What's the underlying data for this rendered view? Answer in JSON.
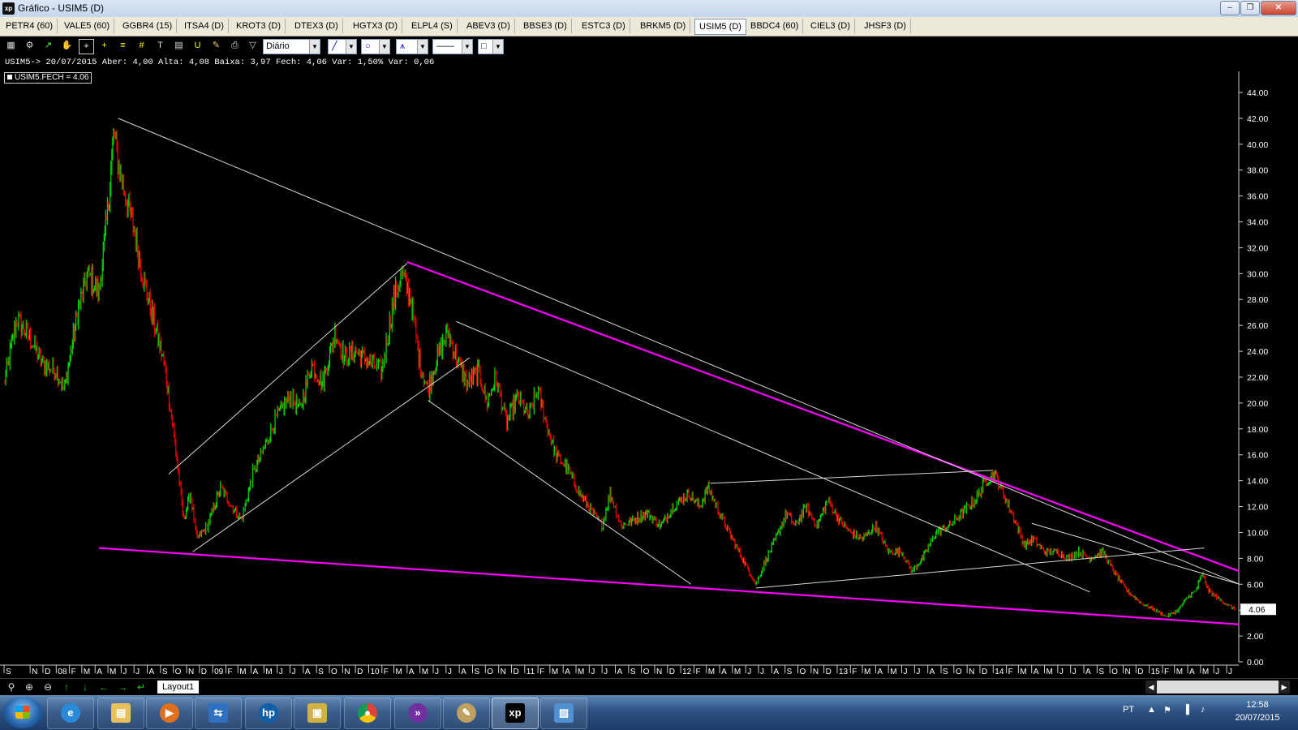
{
  "window": {
    "title": "Gráfico - USIM5 (D)",
    "app_icon": "xp"
  },
  "tabs": [
    "PETR4 (60)",
    "VALE5 (60)",
    "GGBR4 (15)",
    "ITSA4 (D)",
    "KROT3 (D)",
    "DTEX3 (D)",
    "HGTX3 (D)",
    "ELPL4 (S)",
    "ABEV3 (D)",
    "BBSE3 (D)",
    "ESTC3 (D)",
    "BRKM5 (D)",
    "USIM5 (D)",
    "BBDC4 (60)",
    "CIEL3 (D)",
    "JHSF3 (D)"
  ],
  "active_tab": "USIM5 (D)",
  "toolbar": {
    "period": "Diário"
  },
  "info_line": "USIM5-> 20/07/2015 Aber: 4,00 Alta: 4,08 Baixa: 3,97 Fech: 4,06 Var: 1,50% Var: 0,06",
  "legend": "USIM5.FECH = 4.06",
  "bottom": {
    "layout_tab": "Layout1"
  },
  "taskbar": {
    "lang": "PT",
    "time": "12:58",
    "date": "20/07/2015"
  },
  "colors": {
    "up": "#00d000",
    "down": "#e00000",
    "trend_magenta": "#ff00ff",
    "trend_white": "#d8d8d8",
    "background": "#000000"
  },
  "chart_data": {
    "type": "line",
    "title": "",
    "series": [
      {
        "name": "USIM5.FECH",
        "last_value": 4.06
      }
    ],
    "ylim": [
      0,
      45
    ],
    "yticks": [
      "0.00",
      "2.00",
      "4.00",
      "6.00",
      "8.00",
      "10.00",
      "12.00",
      "14.00",
      "16.00",
      "18.00",
      "20.00",
      "22.00",
      "24.00",
      "26.00",
      "28.00",
      "30.00",
      "32.00",
      "34.00",
      "36.00",
      "38.00",
      "40.00",
      "42.00",
      "44.00"
    ],
    "x_start": "2007-09",
    "x_end": "2015-07-20",
    "xticks": [
      {
        "d": "2007-09",
        "l": "S"
      },
      {
        "d": "2007-11",
        "l": "N"
      },
      {
        "d": "2007-12",
        "l": "D"
      },
      {
        "d": "2008-01",
        "l": "08"
      },
      {
        "d": "2008-02",
        "l": "F"
      },
      {
        "d": "2008-03",
        "l": "M"
      },
      {
        "d": "2008-04",
        "l": "A"
      },
      {
        "d": "2008-05",
        "l": "M"
      },
      {
        "d": "2008-06",
        "l": "J"
      },
      {
        "d": "2008-07",
        "l": "J"
      },
      {
        "d": "2008-08",
        "l": "A"
      },
      {
        "d": "2008-09",
        "l": "S"
      },
      {
        "d": "2008-10",
        "l": "O"
      },
      {
        "d": "2008-11",
        "l": "N"
      },
      {
        "d": "2008-12",
        "l": "D"
      },
      {
        "d": "2009-01",
        "l": "09"
      },
      {
        "d": "2009-02",
        "l": "F"
      },
      {
        "d": "2009-03",
        "l": "M"
      },
      {
        "d": "2009-04",
        "l": "A"
      },
      {
        "d": "2009-05",
        "l": "M"
      },
      {
        "d": "2009-06",
        "l": "J"
      },
      {
        "d": "2009-07",
        "l": "J"
      },
      {
        "d": "2009-08",
        "l": "A"
      },
      {
        "d": "2009-09",
        "l": "S"
      },
      {
        "d": "2009-10",
        "l": "O"
      },
      {
        "d": "2009-11",
        "l": "N"
      },
      {
        "d": "2009-12",
        "l": "D"
      },
      {
        "d": "2010-01",
        "l": "10"
      },
      {
        "d": "2010-02",
        "l": "F"
      },
      {
        "d": "2010-03",
        "l": "M"
      },
      {
        "d": "2010-04",
        "l": "A"
      },
      {
        "d": "2010-05",
        "l": "M"
      },
      {
        "d": "2010-06",
        "l": "J"
      },
      {
        "d": "2010-07",
        "l": "J"
      },
      {
        "d": "2010-08",
        "l": "A"
      },
      {
        "d": "2010-09",
        "l": "S"
      },
      {
        "d": "2010-10",
        "l": "O"
      },
      {
        "d": "2010-11",
        "l": "N"
      },
      {
        "d": "2010-12",
        "l": "D"
      },
      {
        "d": "2011-01",
        "l": "11"
      },
      {
        "d": "2011-02",
        "l": "F"
      },
      {
        "d": "2011-03",
        "l": "M"
      },
      {
        "d": "2011-04",
        "l": "A"
      },
      {
        "d": "2011-05",
        "l": "M"
      },
      {
        "d": "2011-06",
        "l": "J"
      },
      {
        "d": "2011-07",
        "l": "J"
      },
      {
        "d": "2011-08",
        "l": "A"
      },
      {
        "d": "2011-09",
        "l": "S"
      },
      {
        "d": "2011-10",
        "l": "O"
      },
      {
        "d": "2011-11",
        "l": "N"
      },
      {
        "d": "2011-12",
        "l": "D"
      },
      {
        "d": "2012-01",
        "l": "12"
      },
      {
        "d": "2012-02",
        "l": "F"
      },
      {
        "d": "2012-03",
        "l": "M"
      },
      {
        "d": "2012-04",
        "l": "A"
      },
      {
        "d": "2012-05",
        "l": "M"
      },
      {
        "d": "2012-06",
        "l": "J"
      },
      {
        "d": "2012-07",
        "l": "J"
      },
      {
        "d": "2012-08",
        "l": "A"
      },
      {
        "d": "2012-09",
        "l": "S"
      },
      {
        "d": "2012-10",
        "l": "O"
      },
      {
        "d": "2012-11",
        "l": "N"
      },
      {
        "d": "2012-12",
        "l": "D"
      },
      {
        "d": "2013-01",
        "l": "13"
      },
      {
        "d": "2013-02",
        "l": "F"
      },
      {
        "d": "2013-03",
        "l": "M"
      },
      {
        "d": "2013-04",
        "l": "A"
      },
      {
        "d": "2013-05",
        "l": "M"
      },
      {
        "d": "2013-06",
        "l": "J"
      },
      {
        "d": "2013-07",
        "l": "J"
      },
      {
        "d": "2013-08",
        "l": "A"
      },
      {
        "d": "2013-09",
        "l": "S"
      },
      {
        "d": "2013-10",
        "l": "O"
      },
      {
        "d": "2013-11",
        "l": "N"
      },
      {
        "d": "2013-12",
        "l": "D"
      },
      {
        "d": "2014-01",
        "l": "14"
      },
      {
        "d": "2014-02",
        "l": "F"
      },
      {
        "d": "2014-03",
        "l": "M"
      },
      {
        "d": "2014-04",
        "l": "A"
      },
      {
        "d": "2014-05",
        "l": "M"
      },
      {
        "d": "2014-06",
        "l": "J"
      },
      {
        "d": "2014-07",
        "l": "J"
      },
      {
        "d": "2014-08",
        "l": "A"
      },
      {
        "d": "2014-09",
        "l": "S"
      },
      {
        "d": "2014-10",
        "l": "O"
      },
      {
        "d": "2014-11",
        "l": "N"
      },
      {
        "d": "2014-12",
        "l": "D"
      },
      {
        "d": "2015-01",
        "l": "15"
      },
      {
        "d": "2015-02",
        "l": "F"
      },
      {
        "d": "2015-03",
        "l": "M"
      },
      {
        "d": "2015-04",
        "l": "A"
      },
      {
        "d": "2015-05",
        "l": "M"
      },
      {
        "d": "2015-06",
        "l": "J"
      },
      {
        "d": "2015-07",
        "l": "J"
      }
    ],
    "price_path": [
      [
        "2007-09-01",
        21.5
      ],
      [
        "2007-10-01",
        26.5
      ],
      [
        "2007-11-01",
        25.0
      ],
      [
        "2007-12-01",
        23.0
      ],
      [
        "2008-01-01",
        22.5
      ],
      [
        "2008-01-20",
        21.0
      ],
      [
        "2008-02-20",
        27.0
      ],
      [
        "2008-03-15",
        30.0
      ],
      [
        "2008-04-10",
        28.5
      ],
      [
        "2008-05-01",
        35.0
      ],
      [
        "2008-05-15",
        41.0
      ],
      [
        "2008-05-25",
        38.5
      ],
      [
        "2008-06-15",
        35.5
      ],
      [
        "2008-07-01",
        33.5
      ],
      [
        "2008-07-20",
        30.0
      ],
      [
        "2008-08-15",
        26.5
      ],
      [
        "2008-09-10",
        23.0
      ],
      [
        "2008-10-01",
        18.0
      ],
      [
        "2008-10-15",
        14.0
      ],
      [
        "2008-10-25",
        11.0
      ],
      [
        "2008-11-10",
        13.0
      ],
      [
        "2008-11-25",
        9.5
      ],
      [
        "2008-12-20",
        10.5
      ],
      [
        "2009-01-20",
        13.5
      ],
      [
        "2009-02-15",
        12.0
      ],
      [
        "2009-03-10",
        11.0
      ],
      [
        "2009-04-05",
        14.5
      ],
      [
        "2009-05-01",
        16.5
      ],
      [
        "2009-06-01",
        19.0
      ],
      [
        "2009-07-01",
        20.5
      ],
      [
        "2009-07-25",
        19.5
      ],
      [
        "2009-08-20",
        23.0
      ],
      [
        "2009-09-15",
        21.5
      ],
      [
        "2009-10-15",
        25.5
      ],
      [
        "2009-11-05",
        23.5
      ],
      [
        "2009-12-01",
        24.0
      ],
      [
        "2010-01-10",
        23.0
      ],
      [
        "2010-02-01",
        22.5
      ],
      [
        "2010-03-01",
        28.0
      ],
      [
        "2010-03-20",
        30.0
      ],
      [
        "2010-04-10",
        28.0
      ],
      [
        "2010-05-01",
        23.0
      ],
      [
        "2010-05-20",
        21.0
      ],
      [
        "2010-06-10",
        23.5
      ],
      [
        "2010-07-05",
        25.5
      ],
      [
        "2010-07-25",
        23.5
      ],
      [
        "2010-08-20",
        21.5
      ],
      [
        "2010-09-15",
        22.5
      ],
      [
        "2010-10-05",
        20.0
      ],
      [
        "2010-10-25",
        22.0
      ],
      [
        "2010-11-20",
        18.5
      ],
      [
        "2010-12-15",
        20.5
      ],
      [
        "2011-01-10",
        19.0
      ],
      [
        "2011-02-01",
        21.0
      ],
      [
        "2011-02-20",
        18.5
      ],
      [
        "2011-03-15",
        16.0
      ],
      [
        "2011-04-10",
        15.0
      ],
      [
        "2011-05-10",
        13.0
      ],
      [
        "2011-06-10",
        11.5
      ],
      [
        "2011-07-01",
        10.5
      ],
      [
        "2011-07-20",
        13.0
      ],
      [
        "2011-08-15",
        10.5
      ],
      [
        "2011-09-15",
        11.0
      ],
      [
        "2011-10-15",
        11.5
      ],
      [
        "2011-11-15",
        10.5
      ],
      [
        "2011-12-15",
        12.0
      ],
      [
        "2012-01-20",
        13.0
      ],
      [
        "2012-02-15",
        12.0
      ],
      [
        "2012-03-05",
        13.5
      ],
      [
        "2012-04-01",
        11.5
      ],
      [
        "2012-05-01",
        9.5
      ],
      [
        "2012-06-01",
        7.5
      ],
      [
        "2012-06-25",
        6.0
      ],
      [
        "2012-07-20",
        8.0
      ],
      [
        "2012-08-10",
        9.5
      ],
      [
        "2012-09-05",
        11.5
      ],
      [
        "2012-09-25",
        10.5
      ],
      [
        "2012-10-20",
        12.0
      ],
      [
        "2012-11-15",
        10.5
      ],
      [
        "2012-12-10",
        12.5
      ],
      [
        "2013-01-05",
        11.0
      ],
      [
        "2013-02-01",
        10.0
      ],
      [
        "2013-03-01",
        9.5
      ],
      [
        "2013-04-01",
        10.5
      ],
      [
        "2013-05-01",
        8.5
      ],
      [
        "2013-06-01",
        8.5
      ],
      [
        "2013-06-25",
        7.0
      ],
      [
        "2013-07-20",
        8.0
      ],
      [
        "2013-08-20",
        10.0
      ],
      [
        "2013-09-20",
        10.5
      ],
      [
        "2013-10-20",
        11.5
      ],
      [
        "2013-11-20",
        12.5
      ],
      [
        "2013-12-15",
        14.0
      ],
      [
        "2014-01-05",
        14.5
      ],
      [
        "2014-01-25",
        13.0
      ],
      [
        "2014-02-20",
        11.0
      ],
      [
        "2014-03-15",
        9.0
      ],
      [
        "2014-04-05",
        9.5
      ],
      [
        "2014-05-01",
        8.5
      ],
      [
        "2014-06-01",
        8.5
      ],
      [
        "2014-06-25",
        8.0
      ],
      [
        "2014-07-20",
        8.5
      ],
      [
        "2014-08-15",
        8.0
      ],
      [
        "2014-09-15",
        8.5
      ],
      [
        "2014-10-10",
        7.0
      ],
      [
        "2014-11-10",
        5.5
      ],
      [
        "2014-12-15",
        4.5
      ],
      [
        "2015-01-15",
        4.0
      ],
      [
        "2015-02-10",
        3.5
      ],
      [
        "2015-03-10",
        4.0
      ],
      [
        "2015-04-01",
        5.0
      ],
      [
        "2015-04-20",
        5.5
      ],
      [
        "2015-05-05",
        6.8
      ],
      [
        "2015-05-20",
        5.5
      ],
      [
        "2015-06-15",
        4.8
      ],
      [
        "2015-07-20",
        4.06
      ]
    ],
    "trendlines": [
      {
        "color": "magenta",
        "from": [
          "2010-04-01",
          30.9
        ],
        "to": [
          "2015-07-31",
          7.0
        ]
      },
      {
        "color": "magenta",
        "from": [
          "2008-04-10",
          8.8
        ],
        "to": [
          "2015-07-31",
          2.9
        ]
      },
      {
        "color": "white",
        "from": [
          "2008-05-25",
          42.0
        ],
        "to": [
          "2015-07-31",
          6.0
        ]
      },
      {
        "color": "white",
        "from": [
          "2008-09-20",
          14.5
        ],
        "to": [
          "2010-04-01",
          30.8
        ]
      },
      {
        "color": "white",
        "from": [
          "2008-11-15",
          8.5
        ],
        "to": [
          "2010-08-25",
          23.5
        ]
      },
      {
        "color": "white",
        "from": [
          "2010-05-20",
          20.2
        ],
        "to": [
          "2012-01-25",
          6.0
        ]
      },
      {
        "color": "white",
        "from": [
          "2010-07-25",
          26.3
        ],
        "to": [
          "2014-08-15",
          5.4
        ]
      },
      {
        "color": "white",
        "from": [
          "2012-03-10",
          13.8
        ],
        "to": [
          "2014-01-01",
          14.8
        ]
      },
      {
        "color": "white",
        "from": [
          "2012-06-25",
          5.7
        ],
        "to": [
          "2015-05-10",
          8.8
        ]
      },
      {
        "color": "white",
        "from": [
          "2014-04-01",
          10.7
        ],
        "to": [
          "2015-07-31",
          6.0
        ]
      }
    ]
  }
}
